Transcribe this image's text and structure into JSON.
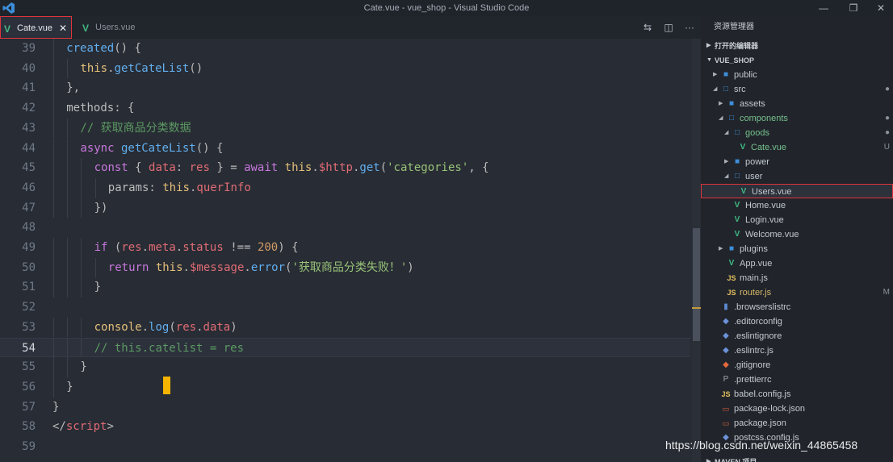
{
  "window": {
    "title": "Cate.vue - vue_shop - Visual Studio Code"
  },
  "tabs": [
    {
      "label": "Cate.vue",
      "active": true
    },
    {
      "label": "Users.vue",
      "active": false
    }
  ],
  "editor": {
    "current_line": "54",
    "lines": [
      {
        "num": "39",
        "indent": 1,
        "tokens": [
          [
            "fn",
            "created"
          ],
          [
            "pu",
            "() {"
          ]
        ]
      },
      {
        "num": "40",
        "indent": 2,
        "tokens": [
          [
            "pr",
            "this"
          ],
          [
            "pu",
            "."
          ],
          [
            "fn",
            "getCateList"
          ],
          [
            "pu",
            "()"
          ]
        ]
      },
      {
        "num": "41",
        "indent": 1,
        "tokens": [
          [
            "pu",
            "},"
          ]
        ]
      },
      {
        "num": "42",
        "indent": 1,
        "tokens": [
          [
            "pu",
            "methods: {"
          ]
        ]
      },
      {
        "num": "43",
        "indent": 2,
        "tokens": [
          [
            "cm",
            "// 获取商品分类数据"
          ]
        ]
      },
      {
        "num": "44",
        "indent": 2,
        "tokens": [
          [
            "kw",
            "async "
          ],
          [
            "fn",
            "getCateList"
          ],
          [
            "pu",
            "() {"
          ]
        ]
      },
      {
        "num": "45",
        "indent": 3,
        "tokens": [
          [
            "kw",
            "const "
          ],
          [
            "pu",
            "{ "
          ],
          [
            "vr",
            "data"
          ],
          [
            "pu",
            ": "
          ],
          [
            "vr",
            "res"
          ],
          [
            "pu",
            " } = "
          ],
          [
            "kw",
            "await "
          ],
          [
            "pr",
            "this"
          ],
          [
            "pu",
            "."
          ],
          [
            "vr",
            "$http"
          ],
          [
            "pu",
            "."
          ],
          [
            "fn",
            "get"
          ],
          [
            "pu",
            "("
          ],
          [
            "str",
            "'categories'"
          ],
          [
            "pu",
            ", {"
          ]
        ]
      },
      {
        "num": "46",
        "indent": 4,
        "tokens": [
          [
            "pu",
            "params: "
          ],
          [
            "pr",
            "this"
          ],
          [
            "pu",
            "."
          ],
          [
            "vr",
            "querInfo"
          ]
        ]
      },
      {
        "num": "47",
        "indent": 3,
        "tokens": [
          [
            "pu",
            "})"
          ]
        ]
      },
      {
        "num": "48",
        "indent": 0,
        "tokens": []
      },
      {
        "num": "49",
        "indent": 3,
        "tokens": [
          [
            "kw",
            "if "
          ],
          [
            "pu",
            "("
          ],
          [
            "vr",
            "res"
          ],
          [
            "pu",
            "."
          ],
          [
            "vr",
            "meta"
          ],
          [
            "pu",
            "."
          ],
          [
            "vr",
            "status"
          ],
          [
            "pu",
            " !== "
          ],
          [
            "num",
            "200"
          ],
          [
            "pu",
            ") {"
          ]
        ]
      },
      {
        "num": "50",
        "indent": 4,
        "tokens": [
          [
            "kw",
            "return "
          ],
          [
            "pr",
            "this"
          ],
          [
            "pu",
            "."
          ],
          [
            "vr",
            "$message"
          ],
          [
            "pu",
            "."
          ],
          [
            "fn",
            "error"
          ],
          [
            "pu",
            "("
          ],
          [
            "str",
            "'获取商品分类失败！'"
          ],
          [
            "pu",
            ")"
          ]
        ]
      },
      {
        "num": "51",
        "indent": 3,
        "tokens": [
          [
            "pu",
            "}"
          ]
        ]
      },
      {
        "num": "52",
        "indent": 0,
        "tokens": []
      },
      {
        "num": "53",
        "indent": 3,
        "tokens": [
          [
            "pr",
            "console"
          ],
          [
            "pu",
            "."
          ],
          [
            "fn",
            "log"
          ],
          [
            "pu",
            "("
          ],
          [
            "vr",
            "res"
          ],
          [
            "pu",
            "."
          ],
          [
            "vr",
            "data"
          ],
          [
            "pu",
            ")"
          ]
        ]
      },
      {
        "num": "54",
        "indent": 3,
        "tokens": [
          [
            "cm",
            "// this.catelist = res"
          ]
        ]
      },
      {
        "num": "55",
        "indent": 2,
        "tokens": [
          [
            "pu",
            "}"
          ]
        ]
      },
      {
        "num": "56",
        "indent": 1,
        "tokens": [
          [
            "pu",
            "}"
          ]
        ]
      },
      {
        "num": "57",
        "indent": 0,
        "tokens": [
          [
            "pu",
            "}"
          ]
        ]
      },
      {
        "num": "58",
        "indent": 0,
        "tokens": [
          [
            "pu",
            "</"
          ],
          [
            "tag",
            "script"
          ],
          [
            "pu",
            ">"
          ]
        ]
      },
      {
        "num": "59",
        "indent": 0,
        "tokens": []
      }
    ]
  },
  "explorer": {
    "title": "资源管理器",
    "sections": [
      "打开的编辑器",
      "VUE_SHOP",
      "MAVEN 项目"
    ],
    "items": [
      {
        "name": "public",
        "depth": 1,
        "kind": "folder",
        "expanded": false,
        "badge": ""
      },
      {
        "name": "src",
        "depth": 1,
        "kind": "folder",
        "expanded": true,
        "badge": "●"
      },
      {
        "name": "assets",
        "depth": 2,
        "kind": "folder",
        "expanded": false,
        "badge": ""
      },
      {
        "name": "components",
        "depth": 2,
        "kind": "folder",
        "expanded": true,
        "badge": "●",
        "color": "green"
      },
      {
        "name": "goods",
        "depth": 3,
        "kind": "folder",
        "expanded": true,
        "badge": "●",
        "color": "green"
      },
      {
        "name": "Cate.vue",
        "depth": 4,
        "kind": "vue",
        "badge": "U",
        "color": "green"
      },
      {
        "name": "power",
        "depth": 3,
        "kind": "folder",
        "expanded": false,
        "badge": ""
      },
      {
        "name": "user",
        "depth": 3,
        "kind": "folder",
        "expanded": true,
        "badge": ""
      },
      {
        "name": "Users.vue",
        "depth": 4,
        "kind": "vue",
        "badge": "",
        "selected": true
      },
      {
        "name": "Home.vue",
        "depth": 3,
        "kind": "vue",
        "badge": ""
      },
      {
        "name": "Login.vue",
        "depth": 3,
        "kind": "vue",
        "badge": ""
      },
      {
        "name": "Welcome.vue",
        "depth": 3,
        "kind": "vue",
        "badge": ""
      },
      {
        "name": "plugins",
        "depth": 2,
        "kind": "folder",
        "expanded": false,
        "badge": ""
      },
      {
        "name": "App.vue",
        "depth": 2,
        "kind": "vue",
        "badge": ""
      },
      {
        "name": "main.js",
        "depth": 2,
        "kind": "js",
        "badge": ""
      },
      {
        "name": "router.js",
        "depth": 2,
        "kind": "js",
        "badge": "M",
        "color": "yellow"
      },
      {
        "name": ".browserslistrc",
        "depth": 1,
        "kind": "plain",
        "badge": ""
      },
      {
        "name": ".editorconfig",
        "depth": 1,
        "kind": "cfg",
        "badge": ""
      },
      {
        "name": ".eslintignore",
        "depth": 1,
        "kind": "cfg",
        "badge": ""
      },
      {
        "name": ".eslintrc.js",
        "depth": 1,
        "kind": "cfg",
        "badge": ""
      },
      {
        "name": ".gitignore",
        "depth": 1,
        "kind": "git",
        "badge": ""
      },
      {
        "name": ".prettierrc",
        "depth": 1,
        "kind": "prettier",
        "badge": ""
      },
      {
        "name": "babel.config.js",
        "depth": 1,
        "kind": "js",
        "badge": ""
      },
      {
        "name": "package-lock.json",
        "depth": 1,
        "kind": "json",
        "badge": ""
      },
      {
        "name": "package.json",
        "depth": 1,
        "kind": "json",
        "badge": ""
      },
      {
        "name": "postcss.config.js",
        "depth": 1,
        "kind": "cfg",
        "badge": ""
      }
    ]
  },
  "watermark": "https://blog.csdn.net/weixin_44865458"
}
